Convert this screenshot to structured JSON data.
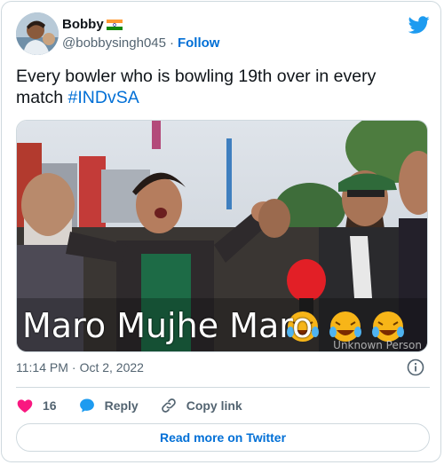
{
  "author": {
    "display_name": "Bobby",
    "handle": "@bobbysingh045",
    "follow_label": "Follow"
  },
  "tweet": {
    "text_before": "Every bowler  who is bowling 19th over in every match ",
    "hashtag": "#INDvSA"
  },
  "media": {
    "caption": "Maro Mujhe Maro",
    "watermark": "Unknown Person"
  },
  "meta": {
    "time": "11:14 PM",
    "date": "Oct 2, 2022"
  },
  "actions": {
    "like_count": "16",
    "reply_label": "Reply",
    "copy_link_label": "Copy link"
  },
  "read_more_label": "Read more on Twitter",
  "colors": {
    "link": "#006fd6",
    "like": "#f91880",
    "twitter_blue": "#1d9bf0",
    "border": "#cfd9de",
    "secondary_text": "#536471"
  }
}
